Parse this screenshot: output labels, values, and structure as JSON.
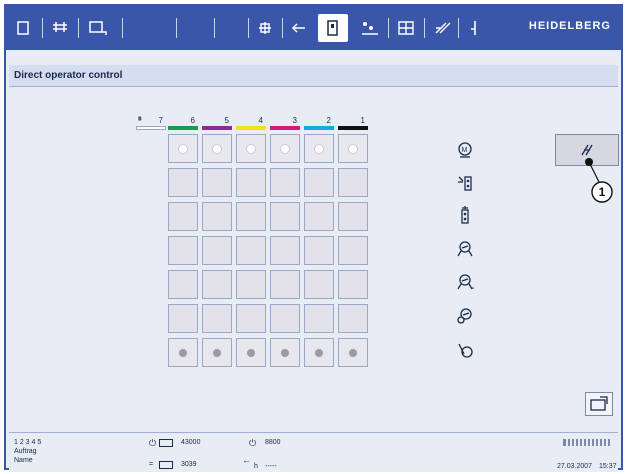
{
  "brand": "HEIDELBERG",
  "title": "Direct operator control",
  "units": [
    {
      "num": "7",
      "color": "#ffffff"
    },
    {
      "num": "6",
      "color": "#1a9a4a"
    },
    {
      "num": "5",
      "color": "#8b2a9a"
    },
    {
      "num": "4",
      "color": "#f2e21a"
    },
    {
      "num": "3",
      "color": "#d11a7a"
    },
    {
      "num": "2",
      "color": "#1aa8e0"
    },
    {
      "num": "1",
      "color": "#111111"
    }
  ],
  "callout": "1",
  "footer": {
    "line1": "1 2 3 4 5",
    "auftrag": "Auftrag",
    "name": "Name",
    "counter1": "43000",
    "counter2": "8800",
    "counter3": "3039",
    "h_label": "h",
    "h_value": "-----",
    "date": "27.03.2007",
    "time": "15:37"
  },
  "colors": {
    "accent": "#3a56a8",
    "panel": "#e8ecf5"
  }
}
